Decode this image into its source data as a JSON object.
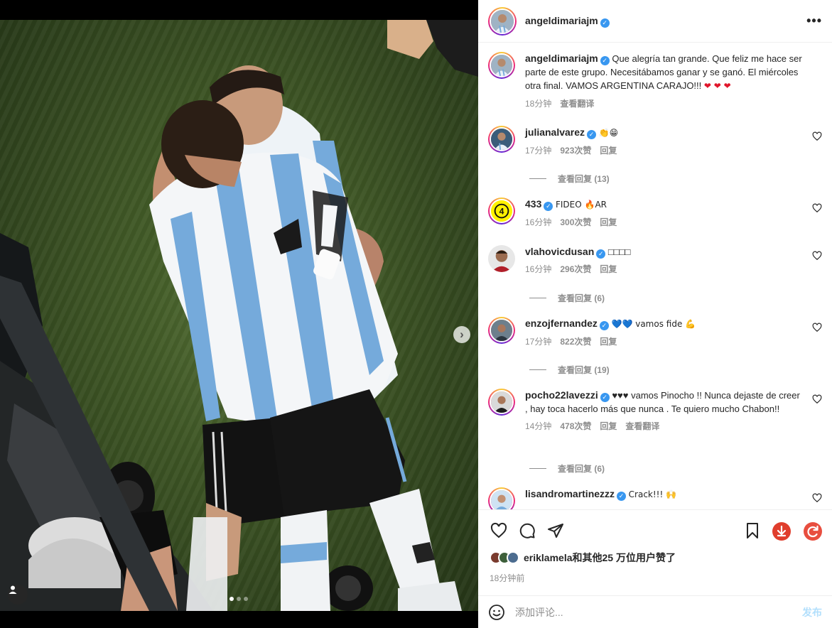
{
  "post": {
    "author": "angeldimariajm",
    "more_label": "•••"
  },
  "caption": {
    "username": "angeldimariajm",
    "text": "Que alegría tan grande. Que feliz me hace ser parte de este grupo. Necesitábamos ganar y se ganó. El miércoles otra final. VAMOS ARGENTINA CARAJO!!!",
    "hearts": "❤ ❤ ❤",
    "time": "18分钟",
    "translate": "查看翻译"
  },
  "comments": [
    {
      "username": "julianalvarez",
      "text": "👏😁",
      "time": "17分钟",
      "likes": "923次赞",
      "reply": "回复",
      "view_replies": "查看回复 (13)"
    },
    {
      "username": "433",
      "text": "FIDEO 🔥AR",
      "time": "16分钟",
      "likes": "300次赞",
      "reply": "回复"
    },
    {
      "username": "vlahovicdusan",
      "text": "□□□□",
      "time": "16分钟",
      "likes": "296次赞",
      "reply": "回复",
      "view_replies": "查看回复 (6)"
    },
    {
      "username": "enzojfernandez",
      "text": "💙💙 vamos fide 💪",
      "time": "17分钟",
      "likes": "822次赞",
      "reply": "回复",
      "view_replies": "查看回复 (19)"
    },
    {
      "username": "pocho22lavezzi",
      "text": "♥♥♥ vamos Pinocho !! Nunca dejaste de creer , hay toca hacerlo más que nunca . Te quiero mucho Chabon!!",
      "time": "14分钟",
      "likes": "478次赞",
      "reply": "回复",
      "translate": "查看翻译",
      "view_replies": "查看回复 (6)"
    },
    {
      "username": "lisandromartinezzz",
      "text": "Crack!!! 🙌"
    }
  ],
  "likes_summary": {
    "user": "eriklamela",
    "rest": "和其他25 万位用户赞了"
  },
  "post_time": "18分钟前",
  "comment_input": {
    "placeholder": "添加评论...",
    "publish_label": "发布"
  },
  "icons": {
    "carousel_next": "›"
  },
  "colors": {
    "verified": "#3897f0",
    "argentina_blue": "#75aadb",
    "download_red": "#e03e2d",
    "publish_blue": "#b2dffc"
  }
}
